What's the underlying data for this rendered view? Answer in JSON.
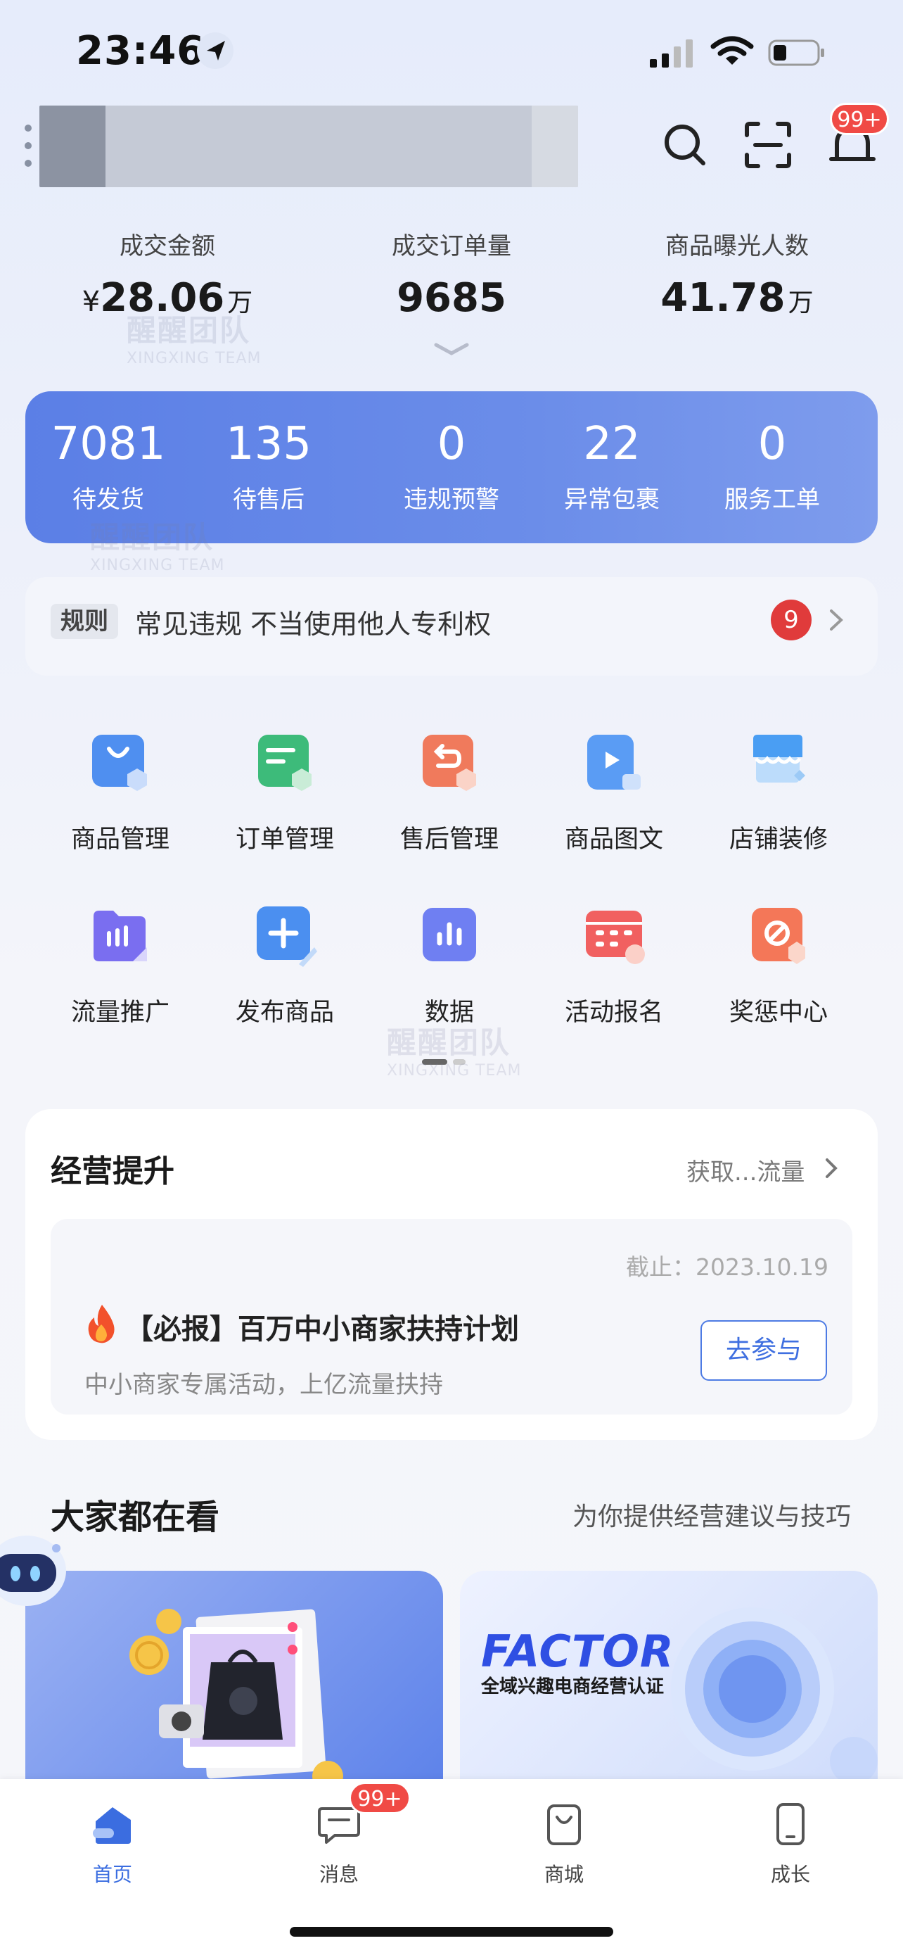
{
  "status_bar": {
    "time": "23:46"
  },
  "header": {
    "notification_badge": "99+"
  },
  "metrics": [
    {
      "label": "成交金额",
      "currency": "¥",
      "value": "28.06",
      "unit": "万"
    },
    {
      "label": "成交订单量",
      "currency": "",
      "value": "9685",
      "unit": ""
    },
    {
      "label": "商品曝光人数",
      "currency": "",
      "value": "41.78",
      "unit": "万"
    }
  ],
  "summary": [
    {
      "value": "7081",
      "label": "待发货"
    },
    {
      "value": "135",
      "label": "待售后"
    },
    {
      "value": "0",
      "label": "违规预警"
    },
    {
      "value": "22",
      "label": "异常包裹"
    },
    {
      "value": "0",
      "label": "服务工单"
    }
  ],
  "notice": {
    "tag": "规则",
    "text": "常见违规 不当使用他人专利权",
    "count": "9"
  },
  "grid": [
    {
      "label": "商品管理",
      "icon": "bag-icon",
      "color": "#4f8ff0"
    },
    {
      "label": "订单管理",
      "icon": "order-icon",
      "color": "#3dbb7a"
    },
    {
      "label": "售后管理",
      "icon": "return-icon",
      "color": "#f07a5c"
    },
    {
      "label": "商品图文",
      "icon": "media-icon",
      "color": "#5a9cf4"
    },
    {
      "label": "店铺装修",
      "icon": "store-icon",
      "color": "#4a9ef3"
    },
    {
      "label": "流量推广",
      "icon": "traffic-icon",
      "color": "#7a6ef0"
    },
    {
      "label": "发布商品",
      "icon": "plus-icon",
      "color": "#4b8ff0"
    },
    {
      "label": "数据",
      "icon": "chart-icon",
      "color": "#6f7ff2"
    },
    {
      "label": "活动报名",
      "icon": "calendar-icon",
      "color": "#f16060"
    },
    {
      "label": "奖惩中心",
      "icon": "ban-icon",
      "color": "#f47758"
    }
  ],
  "business": {
    "title": "经营提升",
    "more": "获取...流量",
    "deadline": "截止：2023.10.19",
    "headline": "【必报】百万中小商家扶持计划",
    "sub": "中小商家专属活动，上亿流量扶持",
    "button": "去参与"
  },
  "watching": {
    "title": "大家都在看",
    "sub": "为你提供经营建议与技巧",
    "factor_word": "FACTOR",
    "factor_sub": "全域兴趣电商经营认证"
  },
  "tabs": [
    {
      "label": "首页",
      "active": true
    },
    {
      "label": "消息",
      "badge": "99+"
    },
    {
      "label": "商城"
    },
    {
      "label": "成长"
    }
  ],
  "colors": {
    "accent": "#3b6de0",
    "badge": "#f04a45",
    "summary_card": "#6285e7"
  }
}
